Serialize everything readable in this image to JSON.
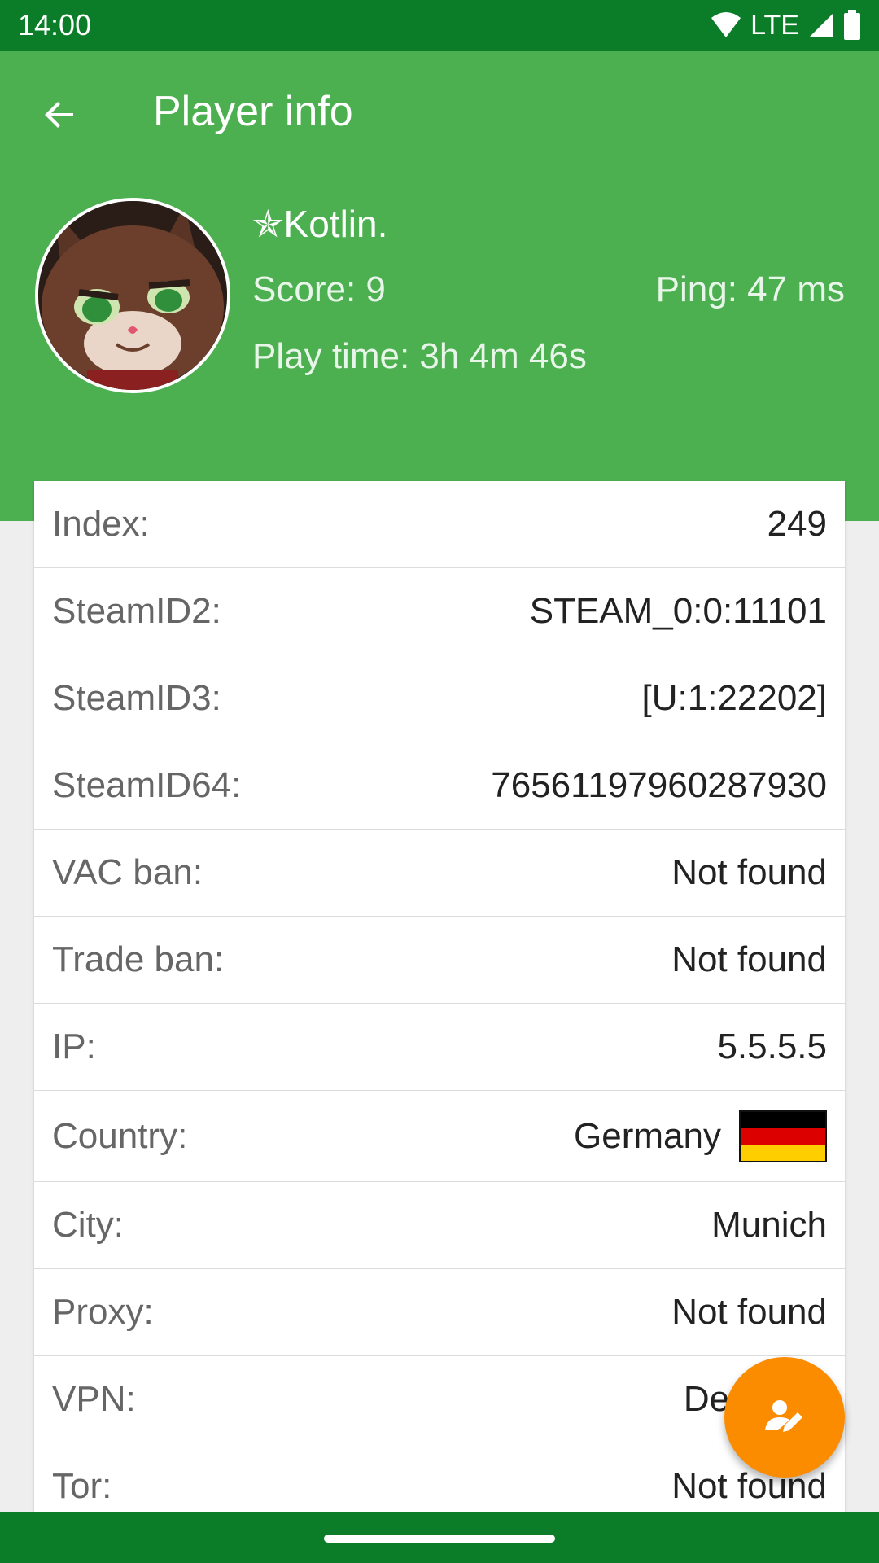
{
  "status_bar": {
    "time": "14:00",
    "network": "LTE",
    "icons": [
      "wifi-icon",
      "cell-signal-icon",
      "battery-icon"
    ]
  },
  "header": {
    "title": "Player info",
    "back_icon": "arrow-back-icon"
  },
  "player": {
    "name": "✯Kotlin.",
    "score": "Score: 9",
    "ping": "Ping: 47 ms",
    "play_time": "Play time: 3h 4m 46s",
    "avatar": "cat-avatar-image"
  },
  "details": [
    {
      "label": "Index:",
      "value": "249"
    },
    {
      "label": "SteamID2:",
      "value": "STEAM_0:0:11101"
    },
    {
      "label": "SteamID3:",
      "value": "[U:1:22202]"
    },
    {
      "label": "SteamID64:",
      "value": "76561197960287930"
    },
    {
      "label": "VAC ban:",
      "value": "Not found"
    },
    {
      "label": "Trade ban:",
      "value": "Not found"
    },
    {
      "label": "IP:",
      "value": "5.5.5.5"
    },
    {
      "label": "Country:",
      "value": "Germany",
      "flag_colors": [
        "#000000",
        "#dd0000",
        "#ffce00"
      ]
    },
    {
      "label": "City:",
      "value": "Munich"
    },
    {
      "label": "Proxy:",
      "value": "Not found"
    },
    {
      "label": "VPN:",
      "value": "Detected"
    },
    {
      "label": "Tor:",
      "value": "Not found"
    }
  ],
  "fab": {
    "icon": "person-edit-icon"
  },
  "colors": {
    "status_bar": "#0b7d28",
    "header": "#4caf50",
    "fab": "#fb8c00",
    "background": "#eeeeee"
  }
}
